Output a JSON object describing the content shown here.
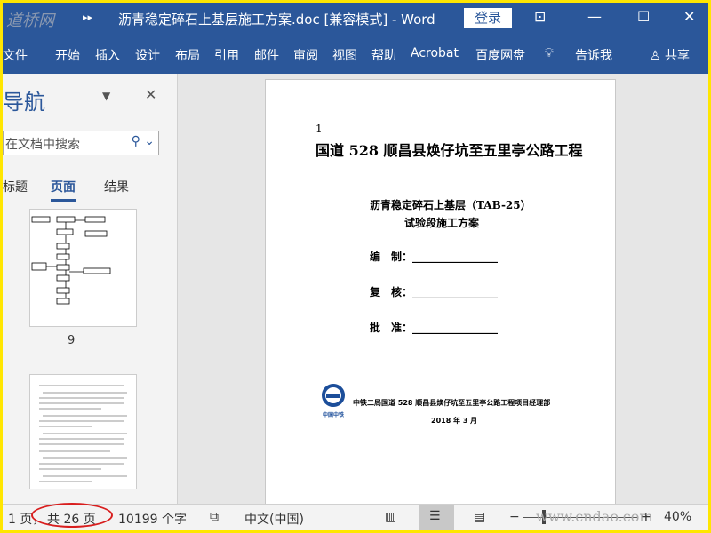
{
  "titlebar": {
    "watermark": "道桥网",
    "title": "沥青稳定碎石上基层施工方案.doc [兼容模式]  -  Word",
    "login": "登录"
  },
  "ribbon": {
    "tabs": [
      "文件",
      "开始",
      "插入",
      "设计",
      "布局",
      "引用",
      "邮件",
      "审阅",
      "视图",
      "帮助",
      "Acrobat",
      "百度网盘",
      "告诉我"
    ],
    "share": "共享"
  },
  "nav": {
    "title": "导航",
    "search_placeholder": "在文档中搜索",
    "tabs": [
      "标题",
      "页面",
      "结果"
    ],
    "page_label": "9"
  },
  "document": {
    "page_num": "1",
    "project": "国道 528 顺昌县焕仔坑至五里亭公路工程",
    "subtitle1": "沥青稳定碎石上基层（TAB-25）",
    "subtitle2": "试验段施工方案",
    "fields": [
      {
        "label": "编　制：",
        "line": "________________"
      },
      {
        "label": "复　核：",
        "line": "________________"
      },
      {
        "label": "批　准：",
        "line": "________________"
      }
    ],
    "logo_text": "中国中铁",
    "org": "中铁二局国道 528 顺昌县焕仔坑至五里亭公路工程项目经理部",
    "date": "2018 年 3 月"
  },
  "status": {
    "page": "1 页，",
    "total": "共 26 页",
    "words": "10199 个字",
    "lang": "中文(中国)",
    "zoom": "40%",
    "watermark": "www.cndao.com"
  }
}
